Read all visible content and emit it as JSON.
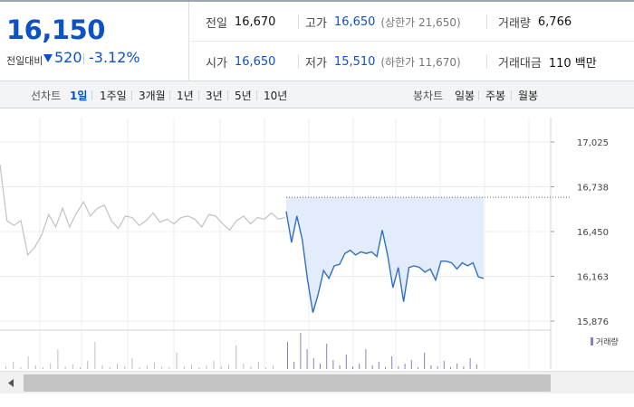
{
  "summary": {
    "current_price": "16,150",
    "diff_label": "전일대비",
    "diff_value": "520",
    "diff_rate": "-3.12%",
    "row1": [
      {
        "label": "전일",
        "value": "16,670",
        "sub": ""
      },
      {
        "label": "고가",
        "value": "16,650",
        "sub": "(상한가 21,650)"
      },
      {
        "label": "거래량",
        "value": "6,766",
        "sub": ""
      }
    ],
    "row2": [
      {
        "label": "시가",
        "value": "16,650",
        "sub": ""
      },
      {
        "label": "저가",
        "value": "15,510",
        "sub": "(하한가 11,670)"
      },
      {
        "label": "거래대금",
        "value": "110 백만",
        "sub": ""
      }
    ]
  },
  "period_bar": {
    "line_label": "선차트",
    "line_periods": [
      "1일",
      "1주일",
      "3개월",
      "1년",
      "3년",
      "5년",
      "10년"
    ],
    "active_period": "1일",
    "candle_label": "봉차트",
    "candle_periods": [
      "일봉",
      "주봉",
      "월봉"
    ]
  },
  "colors": {
    "price_down": "#0b52c6",
    "today_line": "#2f6fc7",
    "today_fill": "#e3ecfa",
    "prev_line": "#c2c2c2",
    "volume_today": "#8b7ec4",
    "volume_prev": "#bdbdbd"
  },
  "chart_data": {
    "type": "line",
    "y_ticks": [
      "17,025",
      "16,738",
      "16,450",
      "16,163",
      "15,876"
    ],
    "ylim": [
      15876,
      17025
    ],
    "prev_close_reference": 16670,
    "volume_legend": "거래량",
    "grid": true,
    "series": [
      {
        "values": [
          16880,
          16520,
          16490,
          16520,
          16300,
          16350,
          16430,
          16560,
          16480,
          16600,
          16480,
          16570,
          16640,
          16550,
          16600,
          16620,
          16520,
          16470,
          16550,
          16540,
          16490,
          16520,
          16570,
          16510,
          16530,
          16500,
          16540,
          16550,
          16530,
          16480,
          16560,
          16550,
          16500,
          16460,
          16520,
          16550,
          16500,
          16540,
          16530,
          16570,
          16530,
          16540
        ]
      },
      {
        "values": [
          16580,
          16380,
          16550,
          16400,
          16140,
          15930,
          16050,
          16200,
          16150,
          16230,
          16240,
          16310,
          16330,
          16300,
          16320,
          16310,
          16320,
          16290,
          16460,
          16300,
          16090,
          16220,
          16000,
          16220,
          16230,
          16220,
          16190,
          16210,
          16140,
          16260,
          16260,
          16250,
          16210,
          16250,
          16230,
          16250,
          16160,
          16150
        ]
      }
    ]
  }
}
